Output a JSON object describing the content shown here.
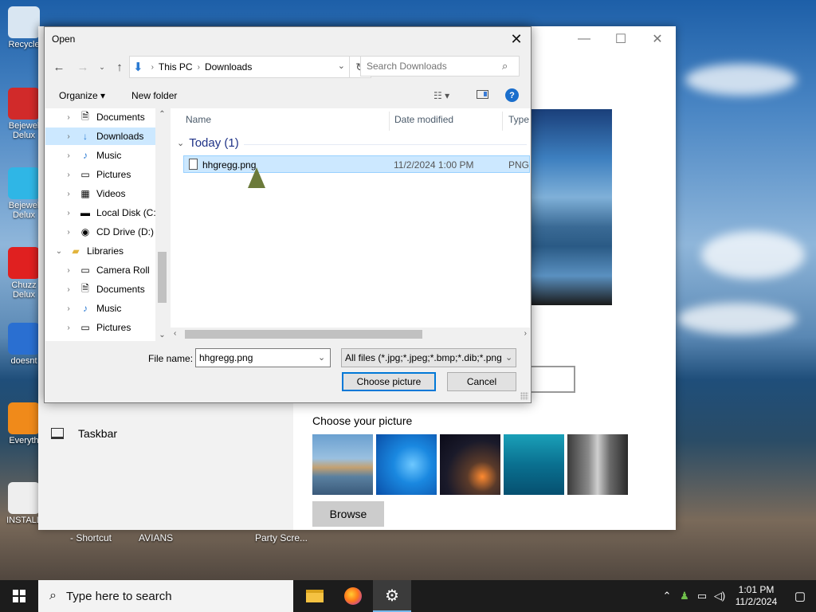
{
  "desktop": {
    "icons": [
      {
        "label": "Recycle",
        "color": "#d9e6f2"
      },
      {
        "label": "Bejewel Delux",
        "color": "#d12a2a"
      },
      {
        "label": "Bejewel Delux",
        "color": "#2fb6e6"
      },
      {
        "label": "Chuzz Delux",
        "color": "#e02020"
      },
      {
        "label": "doesnt",
        "color": "#2a6fd1"
      },
      {
        "label": "Everyth",
        "color": "#f08a1a"
      },
      {
        "label": "INSTALL",
        "color": "#eeeeee"
      }
    ],
    "bottom_labels": [
      "- Shortcut",
      "AVIANS",
      "Party Scre..."
    ]
  },
  "settings": {
    "choose_picture_label": "Choose your picture",
    "browse_label": "Browse",
    "taskbar_label": "Taskbar"
  },
  "dialog": {
    "title": "Open",
    "breadcrumb": [
      "This PC",
      "Downloads"
    ],
    "search_placeholder": "Search Downloads",
    "toolbar": {
      "organize": "Organize",
      "new_folder": "New folder"
    },
    "tree": [
      {
        "label": "Documents",
        "icon": "document-icon",
        "glyph": "🗎",
        "indent": 1,
        "selected": false
      },
      {
        "label": "Downloads",
        "icon": "download-icon",
        "glyph": "↓",
        "indent": 1,
        "selected": true
      },
      {
        "label": "Music",
        "icon": "music-icon",
        "glyph": "♪",
        "indent": 1,
        "selected": false
      },
      {
        "label": "Pictures",
        "icon": "pictures-icon",
        "glyph": "▭",
        "indent": 1,
        "selected": false
      },
      {
        "label": "Videos",
        "icon": "videos-icon",
        "glyph": "▦",
        "indent": 1,
        "selected": false
      },
      {
        "label": "Local Disk (C:)",
        "icon": "drive-icon",
        "glyph": "▬",
        "indent": 1,
        "selected": false
      },
      {
        "label": "CD Drive (D:)",
        "icon": "cd-drive-icon",
        "glyph": "◉",
        "indent": 1,
        "selected": false
      },
      {
        "label": "Libraries",
        "icon": "libraries-icon",
        "glyph": "▰",
        "indent": 0,
        "selected": false
      },
      {
        "label": "Camera Roll",
        "icon": "camera-roll-icon",
        "glyph": "▭",
        "indent": 1,
        "selected": false
      },
      {
        "label": "Documents",
        "icon": "document-icon",
        "glyph": "🗎",
        "indent": 1,
        "selected": false
      },
      {
        "label": "Music",
        "icon": "music-icon",
        "glyph": "♪",
        "indent": 1,
        "selected": false
      },
      {
        "label": "Pictures",
        "icon": "pictures-icon",
        "glyph": "▭",
        "indent": 1,
        "selected": false
      }
    ],
    "columns": {
      "name": "Name",
      "date": "Date modified",
      "type": "Type"
    },
    "group": {
      "label": "Today (1)"
    },
    "files": [
      {
        "name": "hhgregg.png",
        "date": "11/2/2024 1:00 PM",
        "type": "PNG"
      }
    ],
    "file_name_label": "File name:",
    "file_name_value": "hhgregg.png",
    "file_type_value": "All files (*.jpg;*.jpeg;*.bmp;*.dib;*.png",
    "choose_button": "Choose picture",
    "cancel_button": "Cancel"
  },
  "taskbar": {
    "search_placeholder": "Type here to search",
    "time": "1:01 PM",
    "date": "11/2/2024"
  },
  "colors": {
    "accent": "#0078d7",
    "selection": "#cce8ff",
    "taskbar": "#1c1c1c"
  }
}
